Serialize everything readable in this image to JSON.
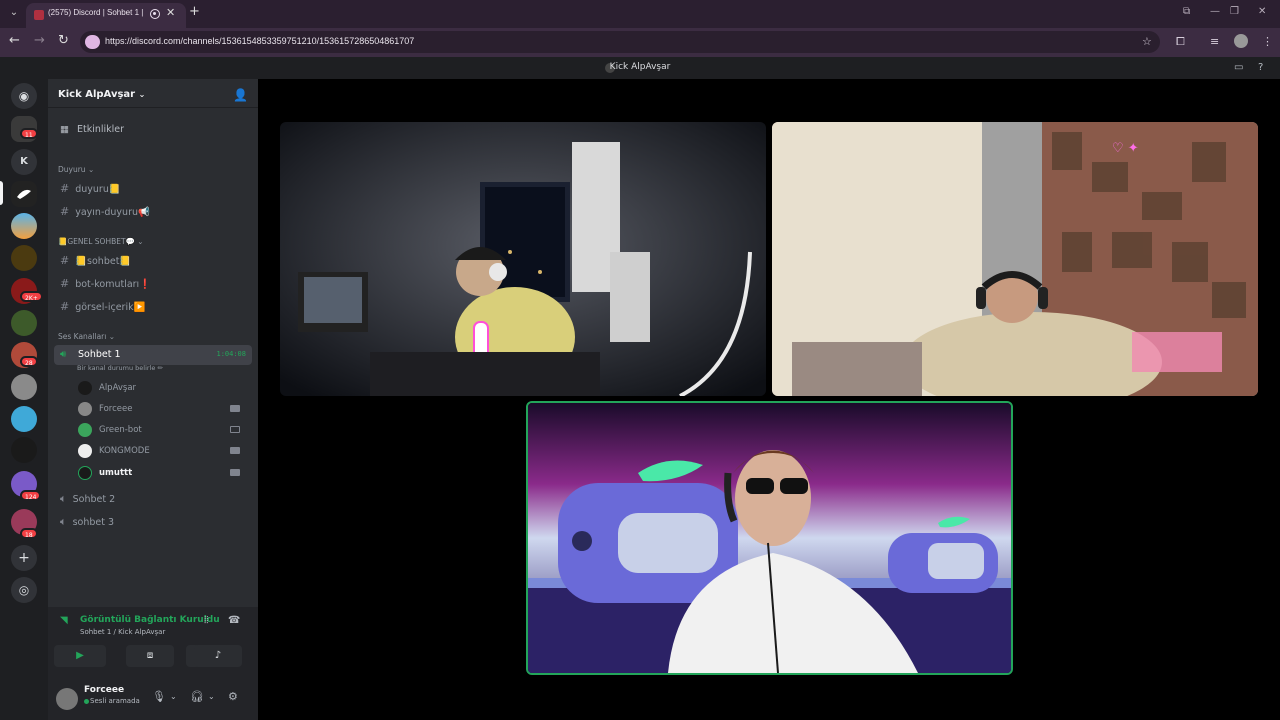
{
  "browser": {
    "tab_title": "(2575) Discord | Sohbet 1 |",
    "url": "https://discord.com/channels/1536154853359751210/1536157286504861707"
  },
  "window": {
    "title": "Kick AlpAvşar"
  },
  "rail": {
    "badges": [
      "11",
      "2K+",
      "28",
      "124",
      "18"
    ],
    "letter_server": "K"
  },
  "guild": {
    "name": "Kick AlpAvşar",
    "events_label": "Etkinlikler",
    "categories": {
      "duyuru": "Duyuru",
      "genel": "📒GENEL SOHBET💬",
      "voice": "Ses Kanalları"
    },
    "text_channels_1": [
      "duyuru📒",
      "yayın-duyuru📢"
    ],
    "text_channels_2": [
      "📒sohbet📒",
      "bot-komutları❗",
      "görsel-içerik▶️"
    ],
    "active_voice": {
      "name": "Sohbet 1",
      "timer": "1:04:08",
      "status_hint": "Bir kanal durumu belirle ✏"
    },
    "voice_users": [
      "AlpAvşar",
      "Forceee",
      "Green-bot",
      "KONGMODE",
      "umuttt"
    ],
    "other_voice": [
      "Sohbet 2",
      "sohbet 3"
    ]
  },
  "connection": {
    "title": "Görüntülü Bağlantı Kuruldu",
    "subtitle": "Sohbet 1 / Kick AlpAvşar"
  },
  "me": {
    "name": "Forceee",
    "status": "Sesli aramada"
  },
  "colors": {
    "green": "#23a55a",
    "sidebar": "#2b2d31",
    "rail": "#1e1f22"
  }
}
